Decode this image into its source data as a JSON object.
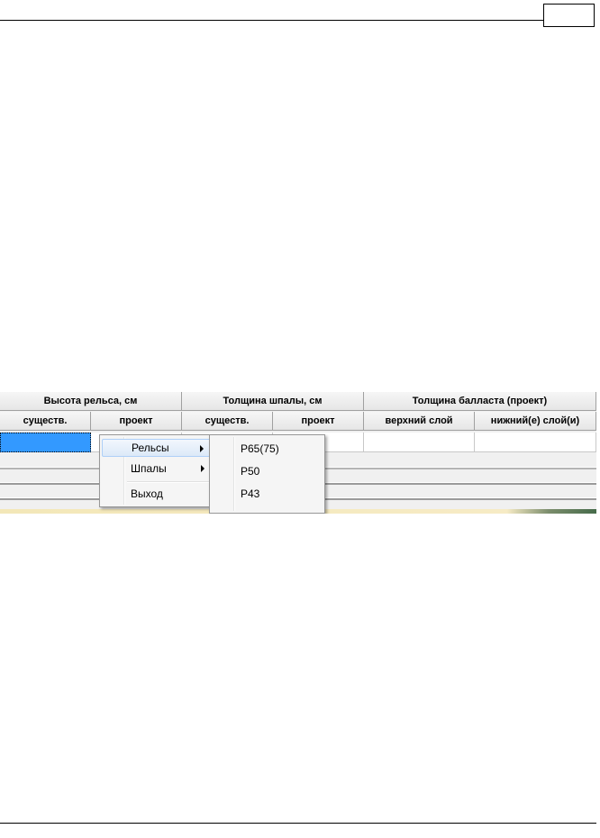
{
  "grid": {
    "group_headers": [
      "Высота рельса, см",
      "Толщина шпалы, см",
      "Толщина балласта (проект)"
    ],
    "column_headers": [
      "существ.",
      "проект",
      "существ.",
      "проект",
      "верхний слой",
      "нижний(е) слой(и)"
    ]
  },
  "context_menu": {
    "items": [
      {
        "label": "Рельсы",
        "has_submenu": true
      },
      {
        "label": "Шпалы",
        "has_submenu": true
      },
      {
        "label": "Выход",
        "has_submenu": false
      }
    ]
  },
  "submenu": {
    "items": [
      "Р65(75)",
      "Р50",
      "Р43"
    ]
  },
  "colors": {
    "selected_cell": "#3399ff",
    "menu_hover": "#dce9f8"
  }
}
